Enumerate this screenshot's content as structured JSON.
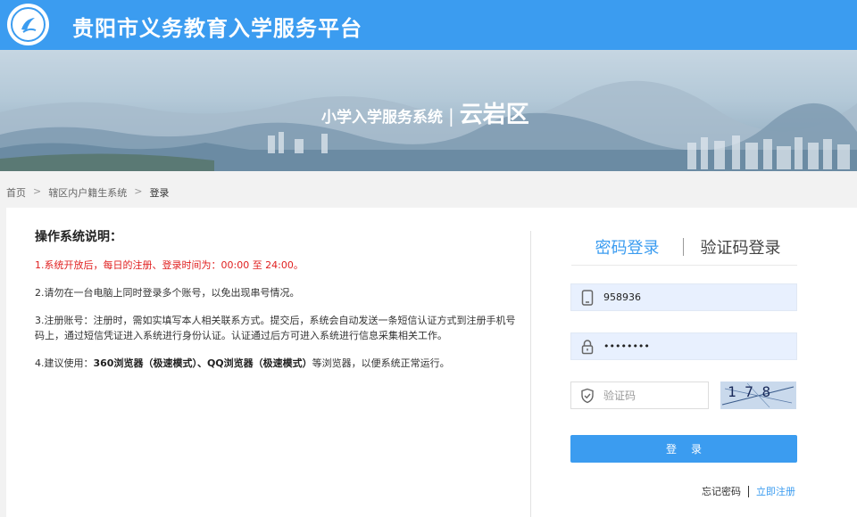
{
  "header": {
    "title": "贵阳市义务教育入学服务平台",
    "logo_icon": "school-logo-icon"
  },
  "banner": {
    "system": "小学入学服务系统",
    "separator": "|",
    "district": "云岩区"
  },
  "breadcrumb": {
    "items": [
      "首页",
      "辖区内户籍生系统",
      "登录"
    ],
    "separator": ">"
  },
  "instructions": {
    "title": "操作系统说明：",
    "line1": "1.系统开放后，每日的注册、登录时间为：00:00 至 24:00。",
    "line2": "2.请勿在一台电脑上同时登录多个账号，以免出现串号情况。",
    "line3": "3.注册账号：注册时，需如实填写本人相关联系方式。提交后，系统会自动发送一条短信认证方式到注册手机号码上，通过短信凭证进入系统进行身份认证。认证通过后方可进入系统进行信息采集相关工作。",
    "line4_prefix": "4.建议使用：",
    "line4_bold": "360浏览器（极速模式）、QQ浏览器（极速模式）",
    "line4_suffix": "等浏览器，以便系统正常运行。"
  },
  "login": {
    "tab_password": "密码登录",
    "tab_sms": "验证码登录",
    "phone_value": "958936",
    "password_value": "••••••••",
    "captcha_placeholder": "验证码",
    "captcha_text": "1 7 8",
    "login_button": "登录",
    "forgot": "忘记密码",
    "register": "立即注册"
  },
  "colors": {
    "primary": "#3b9cf0",
    "warning_text": "#e02020"
  }
}
